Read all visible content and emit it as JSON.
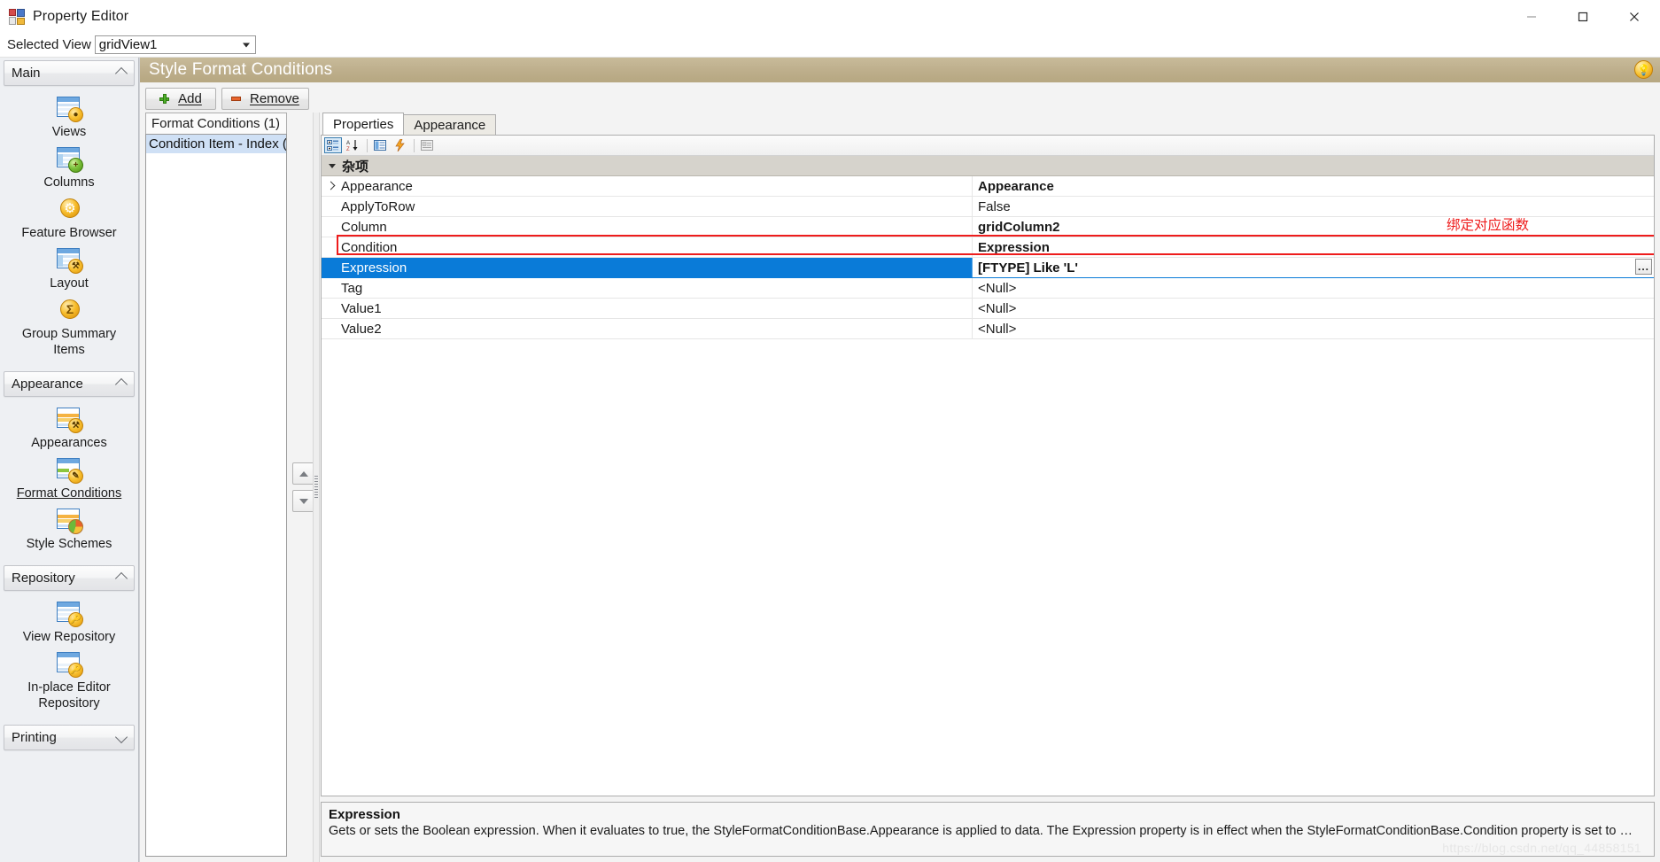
{
  "window": {
    "title": "Property Editor",
    "icon": "property-editor-icon",
    "minimize": "—",
    "maximize": "☐",
    "close": "✕"
  },
  "view_toolbar": {
    "label": "Selected View",
    "combo_value": "gridView1",
    "combo_options": [
      "gridView1"
    ]
  },
  "sidebar": {
    "groups": [
      {
        "title": "Main",
        "expanded": true,
        "items": [
          {
            "label": "Views",
            "icon": "grid-views-icon",
            "active": false
          },
          {
            "label": "Columns",
            "icon": "grid-columns-icon",
            "active": false
          },
          {
            "label": "Feature Browser",
            "icon": "gear-icon",
            "active": false
          },
          {
            "label": "Layout",
            "icon": "grid-layout-icon",
            "active": false
          },
          {
            "label": "Group Summary Items",
            "icon": "sigma-icon",
            "active": false
          }
        ]
      },
      {
        "title": "Appearance",
        "expanded": true,
        "items": [
          {
            "label": "Appearances",
            "icon": "appearances-icon",
            "active": false
          },
          {
            "label": "Format Conditions",
            "icon": "format-conditions-icon",
            "active": true
          },
          {
            "label": "Style Schemes",
            "icon": "style-schemes-icon",
            "active": false
          }
        ]
      },
      {
        "title": "Repository",
        "expanded": true,
        "items": [
          {
            "label": "View Repository",
            "icon": "view-repository-icon",
            "active": false
          },
          {
            "label": "In-place Editor Repository",
            "icon": "inplace-editor-repository-icon",
            "active": false
          }
        ]
      },
      {
        "title": "Printing",
        "expanded": false,
        "items": []
      }
    ]
  },
  "main": {
    "header_title": "Style Format Conditions",
    "header_icon": "bulb-icon",
    "commands": [
      {
        "label": "Add",
        "icon": "plus-icon",
        "mnemonic": "A"
      },
      {
        "label": "Remove",
        "icon": "minus-icon",
        "mnemonic": "R"
      }
    ],
    "list_panel": {
      "header": "Format Conditions (1)",
      "items": [
        "Condition Item - Index ("
      ]
    },
    "nav_buttons": {
      "up": "move-up",
      "down": "move-down"
    },
    "tabs": [
      {
        "label": "Properties",
        "active": true
      },
      {
        "label": "Appearance",
        "active": false
      }
    ],
    "grid_toolbar": [
      {
        "name": "categorized-button",
        "glyph": "▤",
        "selected": true
      },
      {
        "name": "alphabetical-button",
        "glyph": "A↓",
        "selected": false
      },
      {
        "name": "properties-button",
        "glyph": "▤",
        "selected": false
      },
      {
        "name": "events-button",
        "glyph": "⚡",
        "selected": false
      },
      {
        "name": "property-pages-button",
        "glyph": "▧",
        "selected": false
      }
    ],
    "grid": {
      "category": "杂项",
      "rows": [
        {
          "name": "Appearance",
          "value": "Appearance",
          "bold": true,
          "expandable": true,
          "selected": false
        },
        {
          "name": "ApplyToRow",
          "value": "False",
          "bold": false,
          "expandable": false,
          "selected": false
        },
        {
          "name": "Column",
          "value": "gridColumn2",
          "bold": true,
          "expandable": false,
          "selected": false
        },
        {
          "name": "Condition",
          "value": "Expression",
          "bold": true,
          "expandable": false,
          "selected": false
        },
        {
          "name": "Expression",
          "value": "[FTYPE] Like 'L'",
          "bold": true,
          "expandable": false,
          "selected": true,
          "editor_button": "..."
        },
        {
          "name": "Tag",
          "value": "<Null>",
          "bold": false,
          "expandable": false,
          "selected": false
        },
        {
          "name": "Value1",
          "value": "<Null>",
          "bold": false,
          "expandable": false,
          "selected": false
        },
        {
          "name": "Value2",
          "value": "<Null>",
          "bold": false,
          "expandable": false,
          "selected": false
        }
      ]
    },
    "annotation": {
      "text": "绑定对应函数",
      "color": "#ee1c1c",
      "highlight_row": "Condition"
    },
    "description": {
      "title": "Expression",
      "text": "Gets or sets the Boolean expression. When it evaluates to true, the StyleFormatConditionBase.Appearance is applied to data. The Expression property is in effect when the StyleFormatConditionBase.Condition property is set to …"
    },
    "watermark": "https://blog.csdn.net/qq_44858151"
  },
  "colors": {
    "header_bar": "#bdae8b",
    "selection": "#0a7bd8",
    "category_row": "#d6d3cc",
    "annotation": "#ee1c1c"
  }
}
